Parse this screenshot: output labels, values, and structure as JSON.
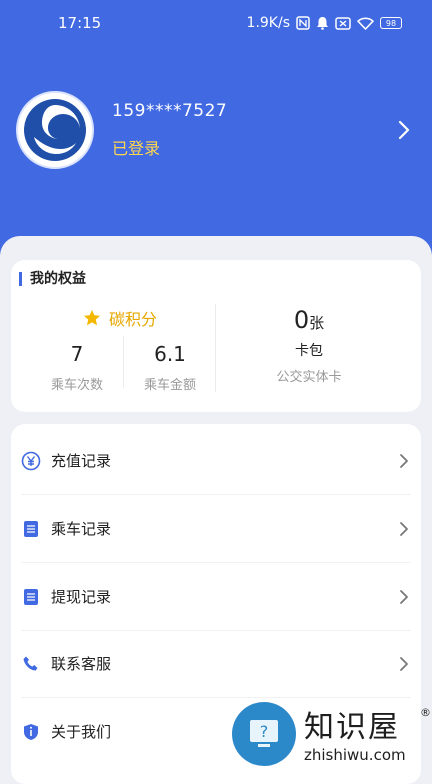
{
  "status_bar": {
    "time": "17:15",
    "net_speed": "1.9K/s",
    "battery": "98"
  },
  "profile": {
    "phone": "159****7527",
    "login_status": "已登录"
  },
  "rights": {
    "title": "我的权益",
    "carbon_label": "碳积分",
    "rides_value": "7",
    "rides_label": "乘车次数",
    "amount_value": "6.1",
    "amount_label": "乘车金额",
    "card_count": "0",
    "card_unit": "张",
    "card_label": "卡包",
    "card_sub": "公交实体卡"
  },
  "menu": {
    "items": [
      {
        "label": "充值记录",
        "icon": "yen-circle-icon"
      },
      {
        "label": "乘车记录",
        "icon": "list-icon"
      },
      {
        "label": "提现记录",
        "icon": "list-icon"
      },
      {
        "label": "联系客服",
        "icon": "phone-icon"
      },
      {
        "label": "关于我们",
        "icon": "shield-info-icon"
      }
    ]
  },
  "watermark": {
    "title": "知识屋",
    "reg": "®",
    "sub": "zhishiwu.com"
  },
  "colors": {
    "primary": "#4169e1",
    "accent_yellow": "#ffd84d",
    "carbon_gold": "#e6a800"
  }
}
